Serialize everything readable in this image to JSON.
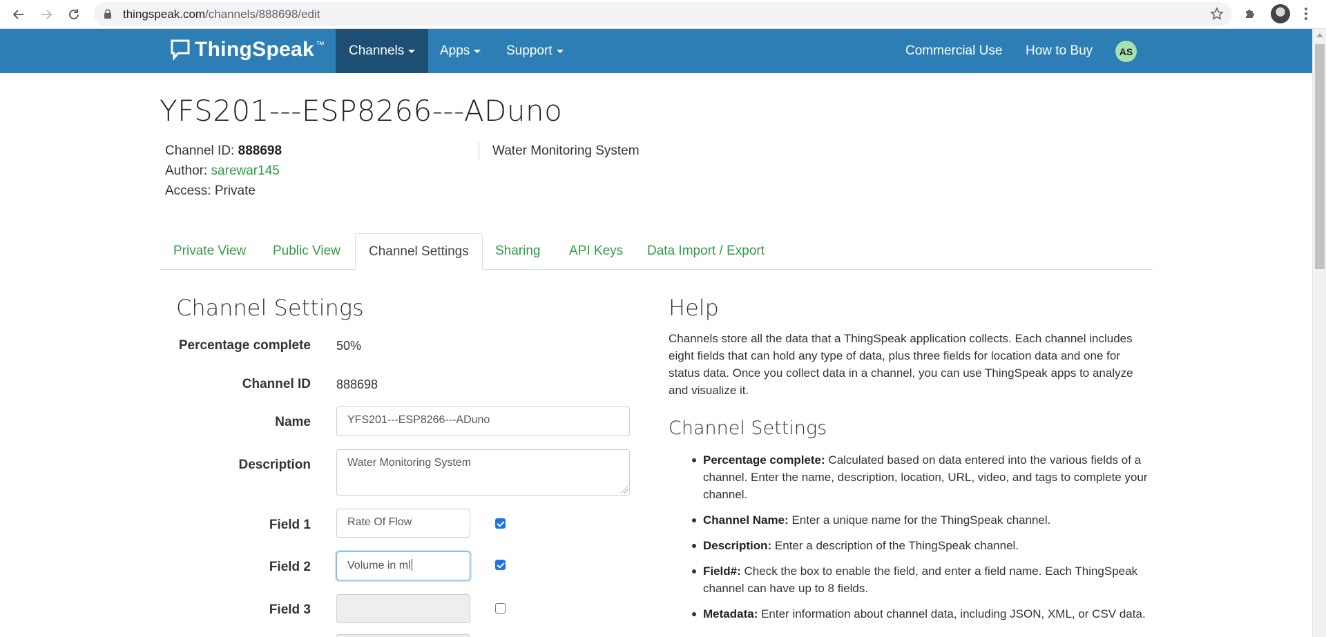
{
  "browser": {
    "url_host": "thingspeak.com",
    "url_path": "/channels/888698/edit"
  },
  "navbar": {
    "logo_text": "ThingSpeak",
    "logo_tm": "™",
    "items": [
      {
        "label": "Channels"
      },
      {
        "label": "Apps"
      },
      {
        "label": "Support"
      }
    ],
    "right_links": [
      {
        "label": "Commercial Use"
      },
      {
        "label": "How to Buy"
      }
    ],
    "avatar_initials": "AS"
  },
  "channel": {
    "title": "YFS201---ESP8266---ADuno",
    "id_label": "Channel ID:",
    "id_value": "888698",
    "author_label": "Author:",
    "author_value": "sarewar145",
    "access_label": "Access:",
    "access_value": "Private",
    "description": "Water Monitoring System"
  },
  "tabs": [
    {
      "label": "Private View"
    },
    {
      "label": "Public View"
    },
    {
      "label": "Channel Settings"
    },
    {
      "label": "Sharing"
    },
    {
      "label": "API Keys"
    },
    {
      "label": "Data Import / Export"
    }
  ],
  "settings_form": {
    "title": "Channel Settings",
    "percentage_label": "Percentage complete",
    "percentage_value": "50%",
    "channel_id_label": "Channel ID",
    "channel_id_value": "888698",
    "name_label": "Name",
    "name_value": "YFS201---ESP8266---ADuno",
    "description_label": "Description",
    "description_value": "Water Monitoring System",
    "fields": [
      {
        "label": "Field 1",
        "value": "Rate Of Flow",
        "enabled": true
      },
      {
        "label": "Field 2",
        "value": "Volume in ml",
        "enabled": true
      },
      {
        "label": "Field 3",
        "value": "",
        "enabled": false
      }
    ]
  },
  "help": {
    "title": "Help",
    "intro": "Channels store all the data that a ThingSpeak application collects. Each channel includes eight fields that can hold any type of data, plus three fields for location data and one for status data. Once you collect data in a channel, you can use ThingSpeak apps to analyze and visualize it.",
    "section_title": "Channel Settings",
    "items": [
      {
        "term": "Percentage complete:",
        "text": " Calculated based on data entered into the various fields of a channel. Enter the name, description, location, URL, video, and tags to complete your channel."
      },
      {
        "term": "Channel Name:",
        "text": " Enter a unique name for the ThingSpeak channel."
      },
      {
        "term": "Description:",
        "text": " Enter a description of the ThingSpeak channel."
      },
      {
        "term": "Field#:",
        "text": " Check the box to enable the field, and enter a field name. Each ThingSpeak channel can have up to 8 fields."
      },
      {
        "term": "Metadata:",
        "text": " Enter information about channel data, including JSON, XML, or CSV data."
      }
    ]
  },
  "colors": {
    "navbar": "#2d7eb5",
    "navbar_active": "#1d4f74",
    "link_green": "#2f9b43",
    "avatar_bg": "#a9e0b2"
  }
}
